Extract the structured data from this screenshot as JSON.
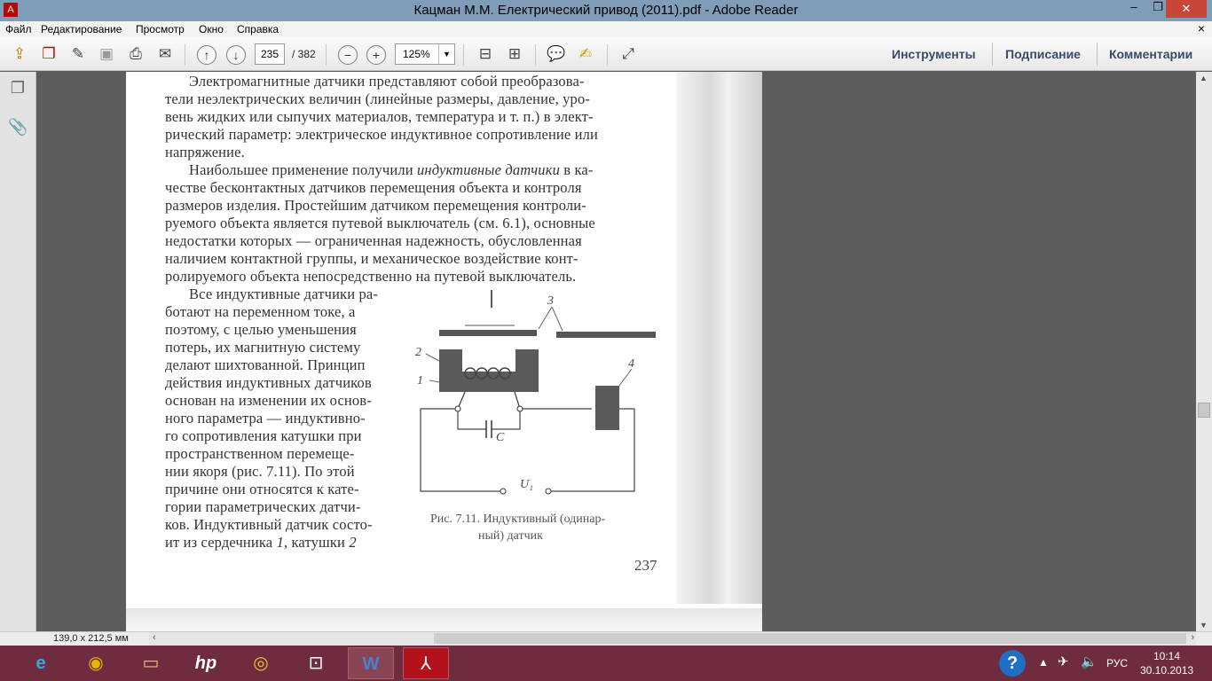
{
  "window": {
    "title": "Кацман М.М. Електрический привод (2011).pdf - Adobe Reader",
    "minimize": "–",
    "restore": "❐",
    "close": "✕"
  },
  "menu": {
    "items": [
      "Файл",
      "Редактирование",
      "Просмотр",
      "Окно",
      "Справка"
    ],
    "close_doc": "×"
  },
  "toolbar": {
    "page_current": "235",
    "page_total": "/ 382",
    "zoom": "125%",
    "zoom_arrow": "▼",
    "panels": [
      "Инструменты",
      "Подписание",
      "Комментарии"
    ]
  },
  "document": {
    "lines_top": [
      "Электромагнитные датчики представляют собой преобразова-",
      "тели неэлектрических величин (линейные размеры, давление, уро-",
      "вень жидких или сыпучих материалов, температура и т. п.) в элект-",
      "рический параметр: электрическое индуктивное сопротивление или",
      "напряжение.",
      "Наибольшее применение получили",
      "индуктивные датчики",
      "в ка-",
      "честве бесконтактных датчиков перемещения объекта и контроля",
      "размеров изделия. Простейшим датчиком перемещения контроли-",
      "руемого объекта является путевой выключатель (см. 6.1), основные",
      "недостатки которых — ограниченная надежность, обусловленная",
      "наличием контактной группы, и механическое воздействие конт-",
      "ролируемого объекта непосредственно на путевой выключатель."
    ],
    "lines_left": [
      "Все индуктивные датчики ра-",
      "ботают на переменном токе, а",
      "поэтому, с целью уменьшения",
      "потерь, их магнитную систему",
      "делают шихтованной. Принцип",
      "действия индуктивных датчиков",
      "основан на изменении их основ-",
      "ного параметра — индуктивно-",
      "го сопротивления катушки при",
      "пространственном перемеще-",
      "нии якоря (рис. 7.11). По этой",
      "причине они относятся к кате-",
      "гории параметрических датчи-",
      "ков. Индуктивный датчик состо-",
      "ит из сердечника"
    ],
    "last_line_italics": [
      "1",
      "2"
    ],
    "last_line_middle": ", катушки",
    "figure": {
      "labels": [
        "1",
        "2",
        "3",
        "4",
        "C",
        "U₁"
      ],
      "caption_line1": "Рис. 7.11. Индуктивный (одинар-",
      "caption_line2": "ный) датчик"
    },
    "page_number": "237"
  },
  "status": {
    "page_size": "139,0 x 212,5 мм"
  },
  "taskbar": {
    "apps": [
      "ie-icon",
      "media-player-icon",
      "file-explorer-icon",
      "hp-icon",
      "chrome-icon",
      "remote-icon",
      "word-icon",
      "acrobat-icon"
    ],
    "help": "?",
    "language": "РУС",
    "time": "10:14",
    "date": "30.10.2013"
  },
  "colors": {
    "titlebar": "#7f9db9",
    "taskbar": "#6f2c3e",
    "doc_background": "#5d5d5d",
    "close_button": "#c7463a",
    "panel_links": "#384b6a"
  }
}
